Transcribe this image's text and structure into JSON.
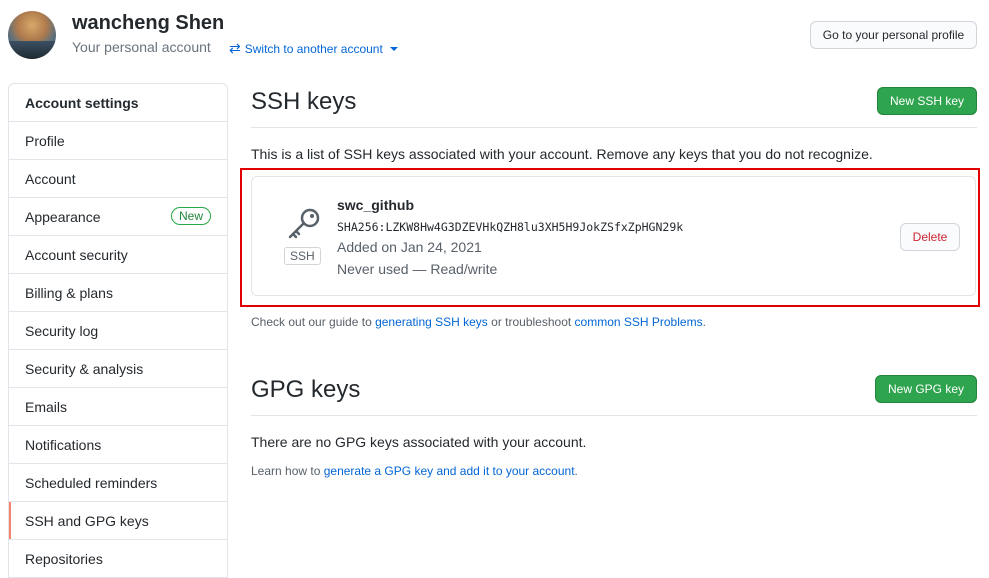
{
  "header": {
    "user_name": "wancheng Shen",
    "subtitle": "Your personal account",
    "switch_label": "Switch to another account",
    "profile_button": "Go to your personal profile"
  },
  "sidebar": {
    "heading": "Account settings",
    "items": [
      {
        "label": "Profile"
      },
      {
        "label": "Account"
      },
      {
        "label": "Appearance",
        "badge": "New"
      },
      {
        "label": "Account security"
      },
      {
        "label": "Billing & plans"
      },
      {
        "label": "Security log"
      },
      {
        "label": "Security & analysis"
      },
      {
        "label": "Emails"
      },
      {
        "label": "Notifications"
      },
      {
        "label": "Scheduled reminders"
      },
      {
        "label": "SSH and GPG keys",
        "active": true
      },
      {
        "label": "Repositories"
      }
    ]
  },
  "ssh": {
    "title": "SSH keys",
    "new_button": "New SSH key",
    "description": "This is a list of SSH keys associated with your account. Remove any keys that you do not recognize.",
    "key": {
      "type_label": "SSH",
      "name": "swc_github",
      "fingerprint": "SHA256:LZKW8Hw4G3DZEVHkQZH8lu3XH5H9JokZSfxZpHGN29k",
      "added": "Added on Jan 24, 2021",
      "usage": "Never used — Read/write",
      "delete_button": "Delete"
    },
    "help_prefix": "Check out our guide to ",
    "help_link1": "generating SSH keys",
    "help_middle": " or troubleshoot ",
    "help_link2": "common SSH Problems",
    "help_suffix": "."
  },
  "gpg": {
    "title": "GPG keys",
    "new_button": "New GPG key",
    "empty_text": "There are no GPG keys associated with your account.",
    "help_prefix": "Learn how to ",
    "help_link": "generate a GPG key and add it to your account",
    "help_suffix": "."
  },
  "colors": {
    "primary_green": "#2ea44f",
    "link_blue": "#0366d6",
    "danger_red": "#cb2431",
    "active_marker": "#f9826c",
    "highlight_box": "#e00000"
  }
}
